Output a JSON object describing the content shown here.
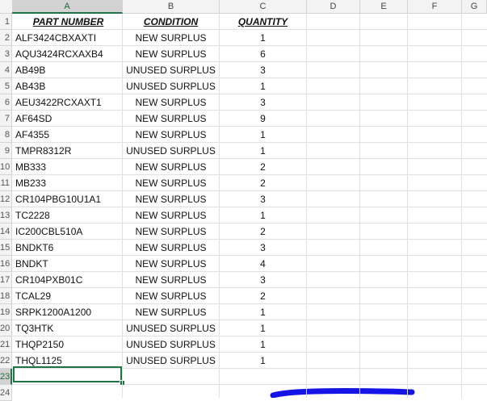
{
  "sheet": {
    "columns": [
      "A",
      "B",
      "C",
      "D",
      "E",
      "F",
      "G"
    ],
    "selected_column": "A",
    "selected_row": "23",
    "row_numbers": [
      "1",
      "2",
      "3",
      "4",
      "5",
      "6",
      "7",
      "8",
      "9",
      "10",
      "11",
      "12",
      "13",
      "14",
      "15",
      "16",
      "17",
      "18",
      "19",
      "20",
      "21",
      "22",
      "23",
      "24"
    ],
    "headers": {
      "part": "PART NUMBER",
      "condition": "CONDITION",
      "quantity": "QUANTITY"
    },
    "rows": [
      {
        "part": "ALF3424CBXAXTI",
        "condition": "NEW SURPLUS",
        "quantity": "1"
      },
      {
        "part": "AQU3424RCXAXB4",
        "condition": "NEW SURPLUS",
        "quantity": "6"
      },
      {
        "part": "AB49B",
        "condition": "UNUSED SURPLUS",
        "quantity": "3"
      },
      {
        "part": "AB43B",
        "condition": "UNUSED SURPLUS",
        "quantity": "1"
      },
      {
        "part": "AEU3422RCXAXT1",
        "condition": "NEW SURPLUS",
        "quantity": "3"
      },
      {
        "part": "AF64SD",
        "condition": "NEW SURPLUS",
        "quantity": "9"
      },
      {
        "part": "AF4355",
        "condition": "NEW SURPLUS",
        "quantity": "1"
      },
      {
        "part": "TMPR8312R",
        "condition": "UNUSED SURPLUS",
        "quantity": "1"
      },
      {
        "part": "MB333",
        "condition": "NEW SURPLUS",
        "quantity": "2"
      },
      {
        "part": "MB233",
        "condition": "NEW SURPLUS",
        "quantity": "2"
      },
      {
        "part": "CR104PBG10U1A1",
        "condition": "NEW SURPLUS",
        "quantity": "3"
      },
      {
        "part": "TC2228",
        "condition": "NEW SURPLUS",
        "quantity": "1"
      },
      {
        "part": "IC200CBL510A",
        "condition": "NEW SURPLUS",
        "quantity": "2"
      },
      {
        "part": "BNDKT6",
        "condition": "NEW SURPLUS",
        "quantity": "3"
      },
      {
        "part": "BNDKT",
        "condition": "NEW SURPLUS",
        "quantity": "4"
      },
      {
        "part": "CR104PXB01C",
        "condition": "NEW SURPLUS",
        "quantity": "3"
      },
      {
        "part": "TCAL29",
        "condition": "NEW SURPLUS",
        "quantity": "2"
      },
      {
        "part": "SRPK1200A1200",
        "condition": "NEW SURPLUS",
        "quantity": "1"
      },
      {
        "part": "TQ3HTK",
        "condition": "UNUSED SURPLUS",
        "quantity": "1"
      },
      {
        "part": "THQP2150",
        "condition": "UNUSED SURPLUS",
        "quantity": "1"
      },
      {
        "part": "THQL1125",
        "condition": "UNUSED SURPLUS",
        "quantity": "1"
      }
    ],
    "colors": {
      "accent": "#217346",
      "pen_stroke": "#1414e6"
    }
  }
}
